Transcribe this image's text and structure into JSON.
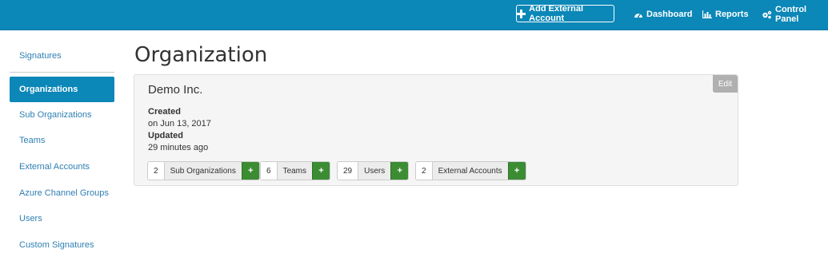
{
  "colors": {
    "brand": "#0b87b8",
    "add_green": "#3c8c34",
    "link": "#2f7fb3",
    "edit_gray": "#b0b0b0"
  },
  "header": {
    "add_external_account": {
      "label": "Add External Account",
      "icon": "plus-icon"
    },
    "nav": [
      {
        "label": "Dashboard",
        "icon": "tachometer-icon"
      },
      {
        "label": "Reports",
        "icon": "bar-chart-icon"
      },
      {
        "label": "Control Panel",
        "icon": "cogs-icon"
      }
    ]
  },
  "sidebar": {
    "items": [
      {
        "label": "Signatures",
        "active": false
      },
      {
        "label": "Organizations",
        "active": true
      },
      {
        "label": "Sub Organizations",
        "active": false
      },
      {
        "label": "Teams",
        "active": false
      },
      {
        "label": "External Accounts",
        "active": false
      },
      {
        "label": "Azure Channel Groups",
        "active": false
      },
      {
        "label": "Users",
        "active": false
      },
      {
        "label": "Custom Signatures",
        "active": false
      }
    ]
  },
  "main": {
    "title": "Organization",
    "org": {
      "name": "Demo Inc.",
      "edit_label": "Edit",
      "created_label": "Created",
      "created_value": "on Jun 13, 2017",
      "updated_label": "Updated",
      "updated_value": "29 minutes ago",
      "stats": [
        {
          "count": "2",
          "label": "Sub Organizations",
          "add": "+"
        },
        {
          "count": "6",
          "label": "Teams",
          "add": "+"
        },
        {
          "count": "29",
          "label": "Users",
          "add": "+"
        },
        {
          "count": "2",
          "label": "External Accounts",
          "add": "+"
        }
      ]
    }
  }
}
